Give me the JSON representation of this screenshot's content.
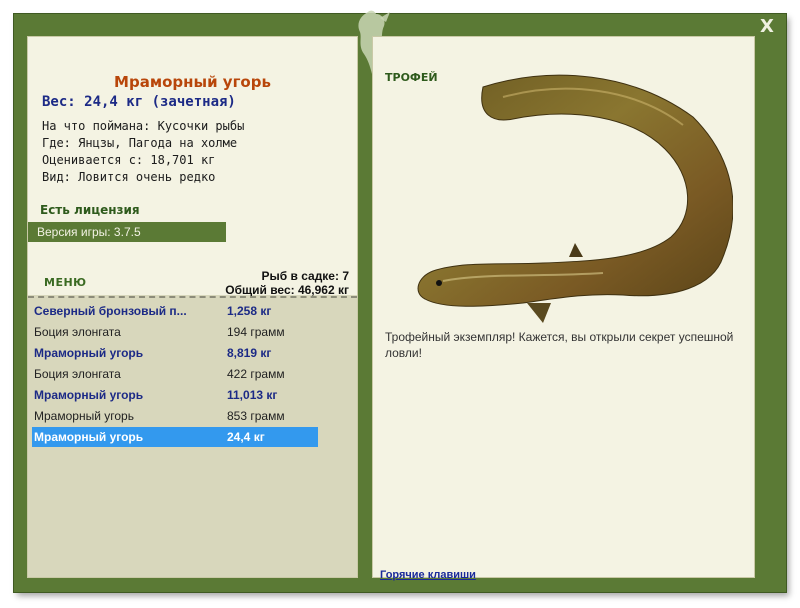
{
  "window": {
    "close_label": "X"
  },
  "fish": {
    "name": "Мраморный угорь",
    "weight_line": "Вес: 24,4 кг (зачетная)",
    "caught_on": "На что поймана: Кусочки рыбы",
    "location": "Где: Янцзы, Пагода на холме",
    "value": "Оценивается с: 18,701 кг",
    "rarity": "Вид: Ловится очень редко"
  },
  "license": "Есть лицензия",
  "version": "Версия игры: 3.7.5",
  "menu_label": "МЕНЮ",
  "keepnet": {
    "count": "Рыб в садке: 7",
    "total_weight": "Общий вес: 46,962 кг"
  },
  "catch_list": [
    {
      "name": "Северный бронзовый п...",
      "weight": "1,258 кг",
      "style": "bold"
    },
    {
      "name": "Боция элонгата",
      "weight": "194 грамм",
      "style": "plain"
    },
    {
      "name": "Мраморный угорь",
      "weight": "8,819 кг",
      "style": "bold"
    },
    {
      "name": "Боция элонгата",
      "weight": "422 грамм",
      "style": "plain"
    },
    {
      "name": "Мраморный угорь",
      "weight": "11,013 кг",
      "style": "bold"
    },
    {
      "name": "Мраморный угорь",
      "weight": "853 грамм",
      "style": "plain"
    },
    {
      "name": "Мраморный угорь",
      "weight": "24,4 кг",
      "style": "selected"
    }
  ],
  "trophy_label": "ТРОФЕЙ",
  "trophy_message": "Трофейный экземпляр! Кажется, вы открыли секрет успешной ловли!",
  "hotkeys_link": "Горячие клавиши",
  "colors": {
    "frame": "#5b7a35",
    "panel": "#f4f3e3",
    "list_bg": "#d8d7bc",
    "selected": "#3399ee",
    "title": "#b8460a",
    "accent_text": "#1c2a86"
  }
}
